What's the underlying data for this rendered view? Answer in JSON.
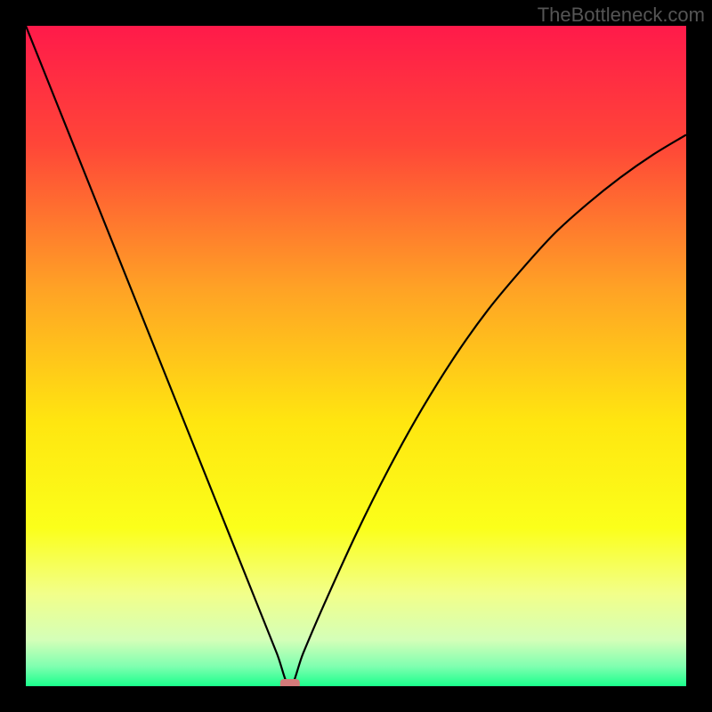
{
  "watermark": "TheBottleneck.com",
  "chart_data": {
    "type": "line",
    "title": "",
    "xlabel": "",
    "ylabel": "",
    "xlim": [
      0,
      100
    ],
    "ylim": [
      0,
      100
    ],
    "x_min_at": 40,
    "series": [
      {
        "name": "bottleneck-curve",
        "x": [
          0,
          5,
          10,
          15,
          20,
          25,
          30,
          35,
          38,
          40,
          42,
          45,
          50,
          55,
          60,
          65,
          70,
          75,
          80,
          85,
          90,
          95,
          100
        ],
        "y": [
          100,
          87.5,
          75,
          62.5,
          50,
          37.5,
          25,
          12.5,
          5,
          0,
          5,
          12,
          23,
          33,
          42,
          50,
          57,
          63,
          68.5,
          73,
          77,
          80.5,
          83.5
        ]
      }
    ],
    "marker": {
      "x": 40,
      "y": 0,
      "color": "#d47a7a"
    },
    "gradient_stops": [
      {
        "pct": 0,
        "color": "#ff1a4a"
      },
      {
        "pct": 18,
        "color": "#ff4638"
      },
      {
        "pct": 40,
        "color": "#ffa325"
      },
      {
        "pct": 60,
        "color": "#ffe610"
      },
      {
        "pct": 76,
        "color": "#fbff1a"
      },
      {
        "pct": 86,
        "color": "#f2ff8a"
      },
      {
        "pct": 93,
        "color": "#d4ffb8"
      },
      {
        "pct": 97,
        "color": "#7fffb0"
      },
      {
        "pct": 100,
        "color": "#1aff8c"
      }
    ]
  }
}
